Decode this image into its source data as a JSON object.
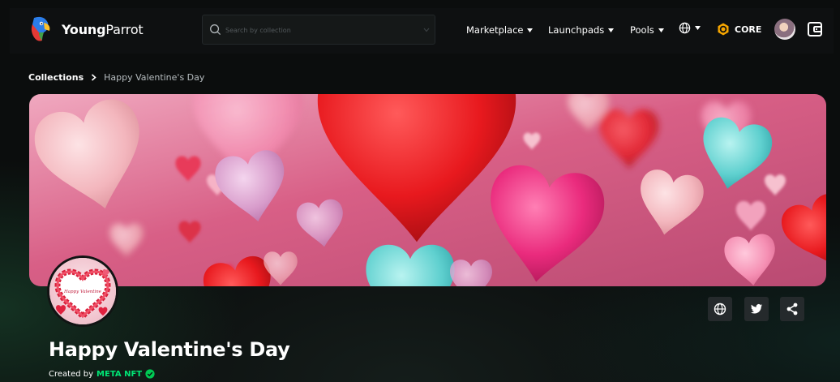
{
  "header": {
    "brand_bold": "Young",
    "brand_rest": "Parrot",
    "search_placeholder": "Search by collection",
    "nav": {
      "marketplace": "Marketplace",
      "launchpads": "Launchpads",
      "pools": "Pools"
    },
    "chain_label": "CORE",
    "icons": {
      "logo": "parrot-logo",
      "search": "search-icon",
      "globe": "globe-icon",
      "chain": "core-coin-icon",
      "wallet": "wallet-icon"
    }
  },
  "breadcrumb": {
    "root": "Collections",
    "current": "Happy Valentine's Day"
  },
  "collection": {
    "title": "Happy Valentine's Day",
    "created_by_label": "Created by",
    "creator": "META NFT",
    "avatar_text": "Happy Valentine",
    "social_icons": [
      "website-globe-icon",
      "twitter-icon",
      "share-icon"
    ]
  },
  "colors": {
    "background": "#0b0d0d",
    "accent_green": "#00e676",
    "chain_orange": "#f7a600",
    "button_bg": "#252a2c"
  }
}
